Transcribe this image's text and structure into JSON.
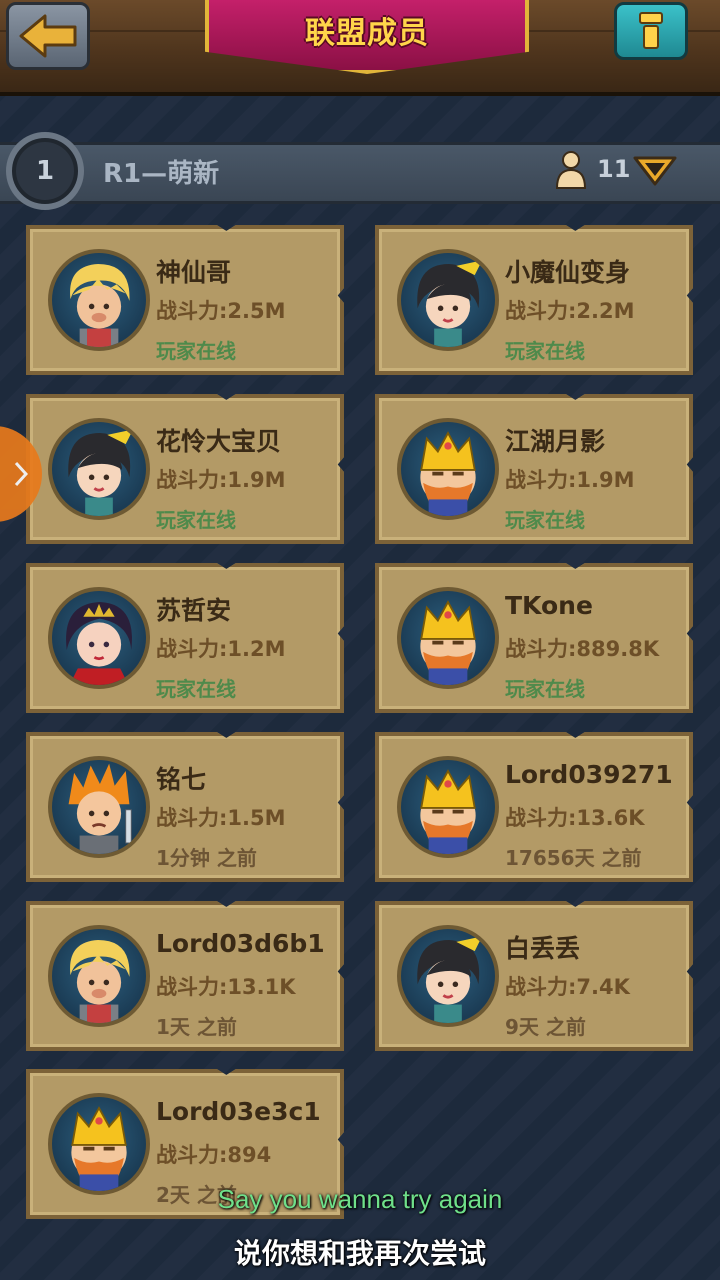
{
  "header": {
    "title": "联盟成员",
    "back_icon": "back-arrow-icon",
    "info_icon": "info-icon"
  },
  "rank_group": {
    "number": "1",
    "label": "R1—萌新",
    "member_count": "11"
  },
  "members": [
    {
      "name": "神仙哥",
      "power": "战斗力:2.5M",
      "status": "玩家在线",
      "online": true,
      "avatar": "blonde-warrior"
    },
    {
      "name": "小魔仙变身",
      "power": "战斗力:2.2M",
      "status": "玩家在线",
      "online": true,
      "avatar": "dark-hair-girl"
    },
    {
      "name": "花怜大宝贝",
      "power": "战斗力:1.9M",
      "status": "玩家在线",
      "online": true,
      "avatar": "dark-hair-girl"
    },
    {
      "name": "江湖月影",
      "power": "战斗力:1.9M",
      "status": "玩家在线",
      "online": true,
      "avatar": "king"
    },
    {
      "name": "苏哲安",
      "power": "战斗力:1.2M",
      "status": "玩家在线",
      "online": true,
      "avatar": "queen"
    },
    {
      "name": "TKone",
      "power": "战斗力:889.8K",
      "status": "玩家在线",
      "online": true,
      "avatar": "king"
    },
    {
      "name": "铭七",
      "power": "战斗力:1.5M",
      "status": "1分钟 之前",
      "online": false,
      "avatar": "spiky-hair-fighter"
    },
    {
      "name": "Lord039271",
      "power": "战斗力:13.6K",
      "status": "17656天 之前",
      "online": false,
      "avatar": "king"
    },
    {
      "name": "Lord03d6b1",
      "power": "战斗力:13.1K",
      "status": "1天 之前",
      "online": false,
      "avatar": "blonde-warrior"
    },
    {
      "name": "白丢丢",
      "power": "战斗力:7.4K",
      "status": "9天 之前",
      "online": false,
      "avatar": "dark-hair-girl"
    },
    {
      "name": "Lord03e3c1",
      "power": "战斗力:894",
      "status": "2天 之前",
      "online": false,
      "avatar": "king"
    }
  ],
  "subtitles": {
    "english": "Say you wanna try again",
    "chinese": "说你想和我再次尝试"
  },
  "colors": {
    "online": "#4f8a4b",
    "card": "#b39a66",
    "banner": "#c4206a"
  }
}
